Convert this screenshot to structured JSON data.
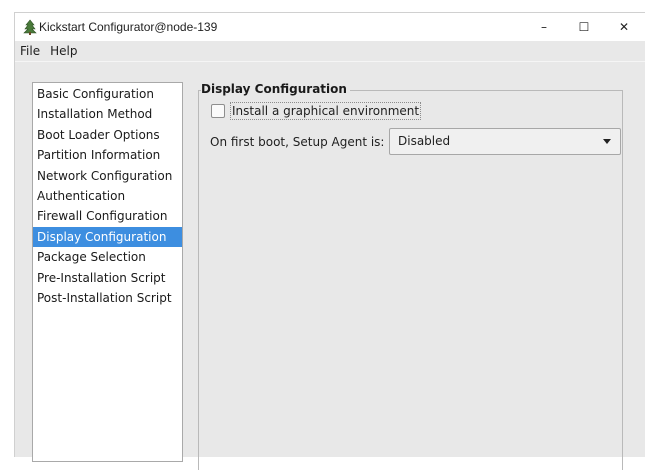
{
  "window": {
    "title": "Kickstart Configurator@node-139",
    "controls": {
      "minimize": "–",
      "maximize": "☐",
      "close": "✕"
    }
  },
  "menu": [
    "File",
    "Help"
  ],
  "sidebar": {
    "items": [
      "Basic Configuration",
      "Installation Method",
      "Boot Loader Options",
      "Partition Information",
      "Network Configuration",
      "Authentication",
      "Firewall Configuration",
      "Display Configuration",
      "Package Selection",
      "Pre-Installation Script",
      "Post-Installation Script"
    ],
    "selected": "Display Configuration"
  },
  "display": {
    "group_title": "Display Configuration",
    "graphical_env_label": "Install a graphical environment",
    "graphical_env_checked": false,
    "setup_agent_label": "On first boot, Setup Agent is:",
    "setup_agent_value": "Disabled"
  },
  "colors": {
    "selection": "#3d8ee0",
    "window_bg": "#e8e8e8"
  },
  "icons": {
    "app": "tree-icon",
    "dropdown": "chevron-down-icon"
  }
}
